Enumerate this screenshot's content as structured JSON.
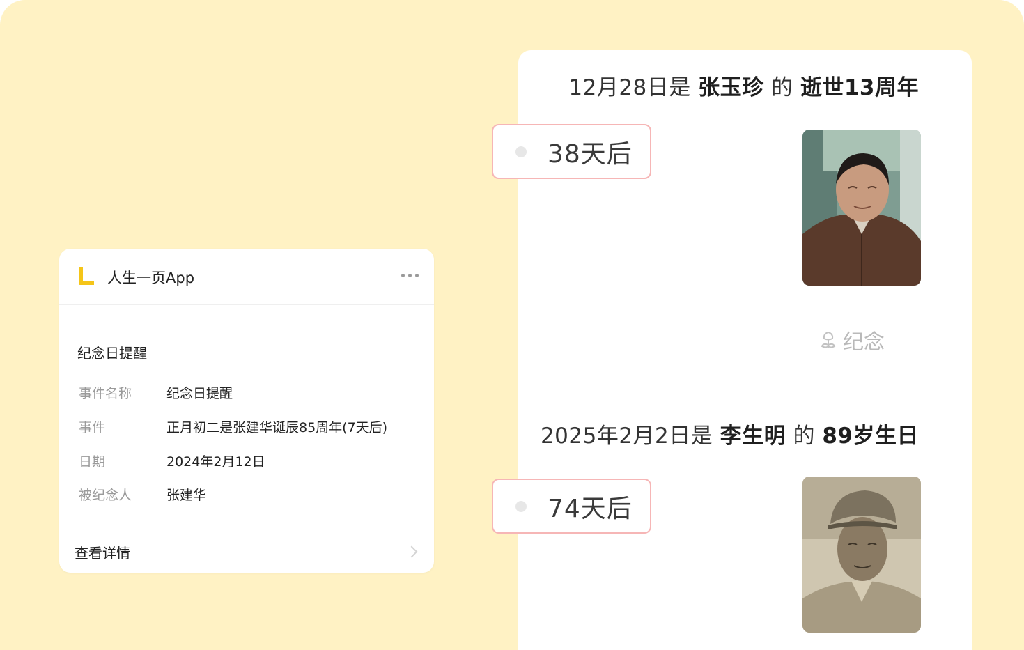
{
  "timeline": {
    "events": [
      {
        "date_text": "12月28日是",
        "person": "张玉珍",
        "connector": "的",
        "occasion": "逝世13周年",
        "countdown": "38天后"
      },
      {
        "date_text": "2025年2月2日是",
        "person": "李生明",
        "connector": "的",
        "occasion": "89岁生日",
        "countdown": "74天后"
      }
    ],
    "commemorate_label": "纪念"
  },
  "notification": {
    "app_name": "人生一页App",
    "title": "纪念日提醒",
    "fields": [
      {
        "label": "事件名称",
        "value": "纪念日提醒"
      },
      {
        "label": "事件",
        "value": "正月初二是张建华诞辰85周年(7天后)"
      },
      {
        "label": "日期",
        "value": "2024年2月12日"
      },
      {
        "label": "被纪念人",
        "value": "张建华"
      }
    ],
    "detail_label": "查看详情"
  },
  "colors": {
    "background": "#fff2c4",
    "badge_border": "#f6b6b6",
    "logo_yellow": "#f5c518"
  }
}
